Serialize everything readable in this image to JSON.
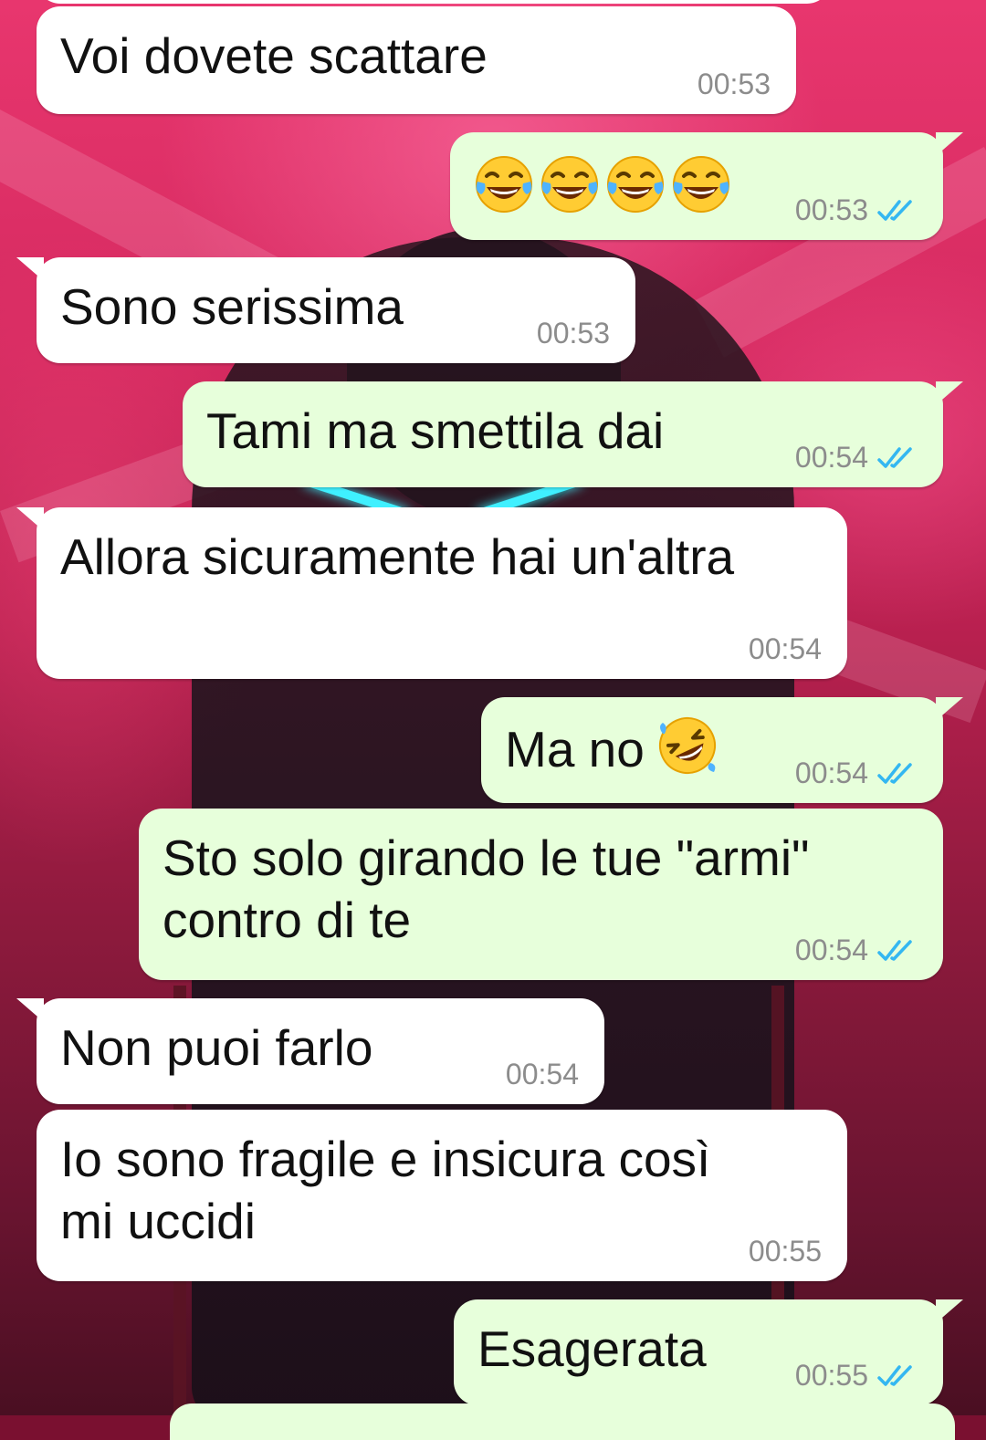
{
  "messages": [
    {
      "direction": "in",
      "text": "Voi dovete scattare",
      "time": "00:53"
    },
    {
      "direction": "out",
      "text": "",
      "emojis": [
        "face-with-tears-of-joy-icon",
        "face-with-tears-of-joy-icon",
        "face-with-tears-of-joy-icon",
        "face-with-tears-of-joy-icon"
      ],
      "time": "00:53",
      "status": "read"
    },
    {
      "direction": "in",
      "text": "Sono serissima",
      "time": "00:53"
    },
    {
      "direction": "out",
      "text": "Tami ma smettila dai",
      "time": "00:54",
      "status": "read"
    },
    {
      "direction": "in",
      "text": "Allora sicuramente hai un'altra",
      "time": "00:54"
    },
    {
      "direction": "out",
      "text": "Ma no",
      "emojis": [
        "rolling-on-floor-laughing-icon"
      ],
      "time": "00:54",
      "status": "read"
    },
    {
      "direction": "out",
      "text": "Sto solo girando le tue \"armi\"\ncontro di te",
      "time": "00:54",
      "status": "read"
    },
    {
      "direction": "in",
      "text": "Non puoi farlo",
      "time": "00:54"
    },
    {
      "direction": "in",
      "text": "Io sono fragile e insicura così\nmi uccidi",
      "time": "00:55"
    },
    {
      "direction": "out",
      "text": "Esagerata",
      "time": "00:55",
      "status": "read"
    }
  ],
  "colors": {
    "incoming_bubble": "#ffffff",
    "outgoing_bubble": "#e7ffdb",
    "read_ticks": "#34b7f1",
    "timestamp": "#8c8c8c",
    "wallpaper_primary": "#e8366e",
    "wallpaper_dark": "#4a0f22"
  }
}
